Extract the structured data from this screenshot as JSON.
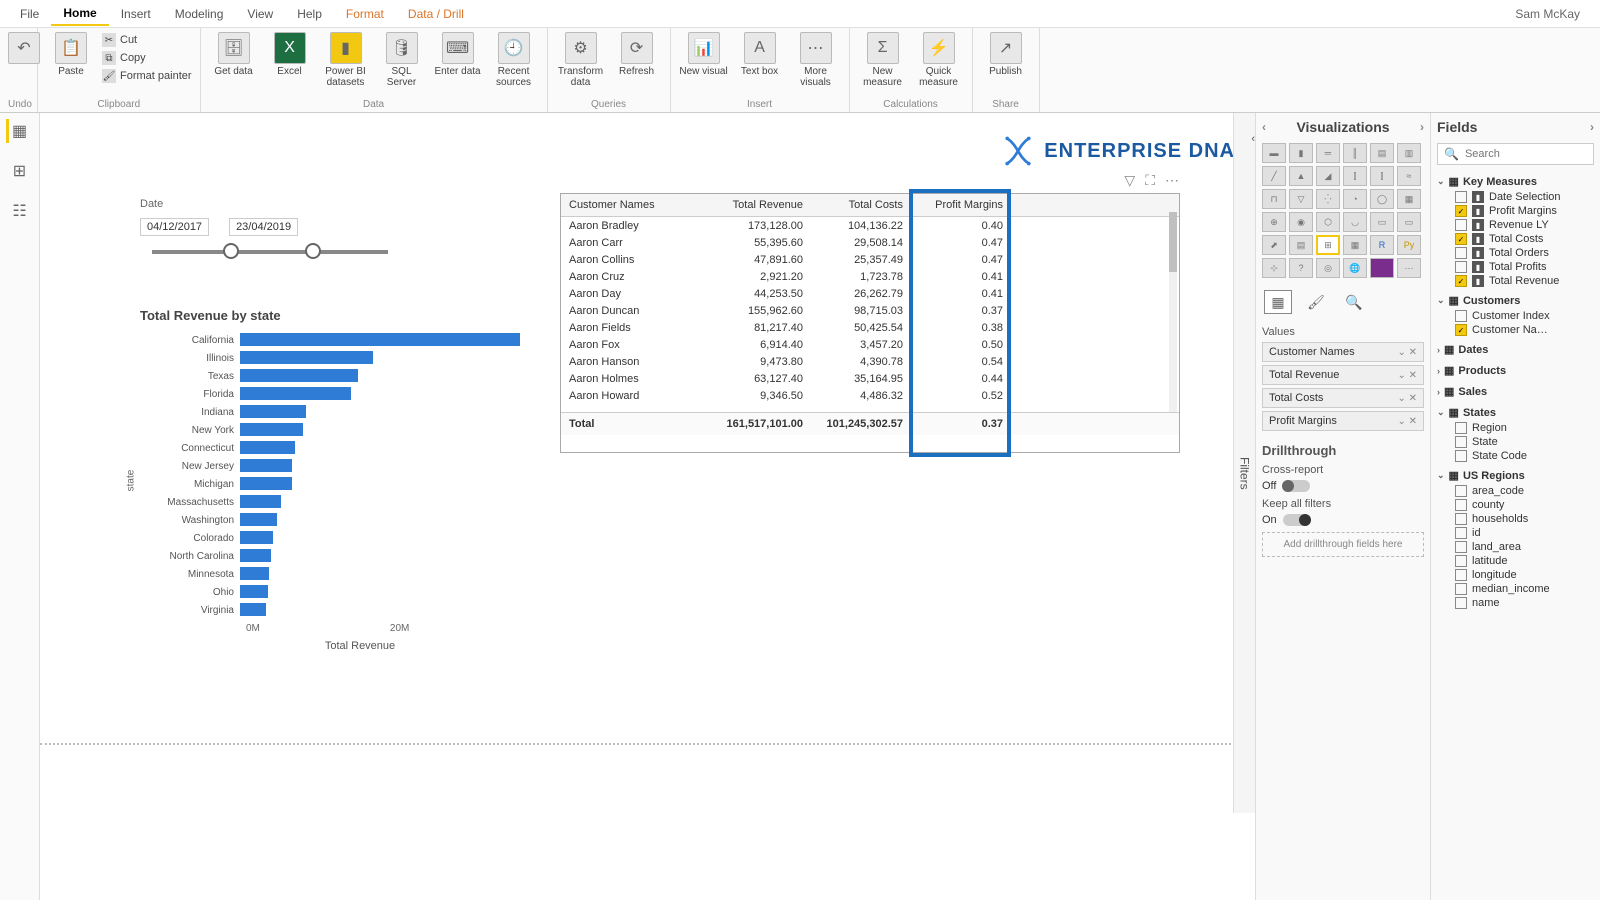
{
  "user": "Sam McKay",
  "menu": {
    "file": "File",
    "home": "Home",
    "insert": "Insert",
    "modeling": "Modeling",
    "view": "View",
    "help": "Help",
    "format": "Format",
    "datadrill": "Data / Drill"
  },
  "ribbon": {
    "undo": "Undo",
    "paste": "Paste",
    "cut": "Cut",
    "copy": "Copy",
    "formatpainter": "Format painter",
    "clipboard": "Clipboard",
    "getdata": "Get data",
    "excel": "Excel",
    "pbidata": "Power BI datasets",
    "sqlserver": "SQL Server",
    "enterdata": "Enter data",
    "recentsources": "Recent sources",
    "data": "Data",
    "transform": "Transform data",
    "refresh": "Refresh",
    "queries": "Queries",
    "newvisual": "New visual",
    "textbox": "Text box",
    "morevisuals": "More visuals",
    "insert": "Insert",
    "newmeasure": "New measure",
    "quickmeasure": "Quick measure",
    "calculations": "Calculations",
    "publish": "Publish",
    "share": "Share"
  },
  "logo": "ENTERPRISE DNA",
  "dateSlicer": {
    "title": "Date",
    "from": "04/12/2017",
    "to": "23/04/2019"
  },
  "chart_data": {
    "type": "bar",
    "title": "Total Revenue by state",
    "xlabel": "Total Revenue",
    "ylabel": "state",
    "xticks": [
      "0M",
      "20M"
    ],
    "categories": [
      "California",
      "Illinois",
      "Texas",
      "Florida",
      "Indiana",
      "New York",
      "Connecticut",
      "New Jersey",
      "Michigan",
      "Massachusetts",
      "Washington",
      "Colorado",
      "North Carolina",
      "Minnesota",
      "Ohio",
      "Virginia"
    ],
    "values": [
      38,
      18,
      16,
      15,
      9,
      8.5,
      7.5,
      7,
      7,
      5.5,
      5,
      4.5,
      4.2,
      4,
      3.8,
      3.5
    ]
  },
  "table": {
    "headers": [
      "Customer Names",
      "Total Revenue",
      "Total Costs",
      "Profit Margins"
    ],
    "rows": [
      [
        "Aaron Bradley",
        "173,128.00",
        "104,136.22",
        "0.40"
      ],
      [
        "Aaron Carr",
        "55,395.60",
        "29,508.14",
        "0.47"
      ],
      [
        "Aaron Collins",
        "47,891.60",
        "25,357.49",
        "0.47"
      ],
      [
        "Aaron Cruz",
        "2,921.20",
        "1,723.78",
        "0.41"
      ],
      [
        "Aaron Day",
        "44,253.50",
        "26,262.79",
        "0.41"
      ],
      [
        "Aaron Duncan",
        "155,962.60",
        "98,715.03",
        "0.37"
      ],
      [
        "Aaron Fields",
        "81,217.40",
        "50,425.54",
        "0.38"
      ],
      [
        "Aaron Fox",
        "6,914.40",
        "3,457.20",
        "0.50"
      ],
      [
        "Aaron Hanson",
        "9,473.80",
        "4,390.78",
        "0.54"
      ],
      [
        "Aaron Holmes",
        "63,127.40",
        "35,164.95",
        "0.44"
      ],
      [
        "Aaron Howard",
        "9,346.50",
        "4,486.32",
        "0.52"
      ]
    ],
    "footer": [
      "Total",
      "161,517,101.00",
      "101,245,302.57",
      "0.37"
    ]
  },
  "filters_label": "Filters",
  "viz": {
    "title": "Visualizations",
    "values": "Values",
    "wells": [
      "Customer Names",
      "Total Revenue",
      "Total Costs",
      "Profit Margins"
    ],
    "drill": "Drillthrough",
    "cross": "Cross-report",
    "off": "Off",
    "on": "On",
    "keep": "Keep all filters",
    "drilldrop": "Add drillthrough fields here"
  },
  "fields": {
    "title": "Fields",
    "search": "Search",
    "tables": [
      {
        "name": "Key Measures",
        "expanded": true,
        "items": [
          {
            "name": "Date Selection",
            "checked": false,
            "type": "m"
          },
          {
            "name": "Profit Margins",
            "checked": true,
            "type": "m"
          },
          {
            "name": "Revenue LY",
            "checked": false,
            "type": "m"
          },
          {
            "name": "Total Costs",
            "checked": true,
            "type": "m"
          },
          {
            "name": "Total Orders",
            "checked": false,
            "type": "m"
          },
          {
            "name": "Total Profits",
            "checked": false,
            "type": "m"
          },
          {
            "name": "Total Revenue",
            "checked": true,
            "type": "m"
          }
        ]
      },
      {
        "name": "Customers",
        "expanded": true,
        "items": [
          {
            "name": "Customer Index",
            "checked": false,
            "type": "c"
          },
          {
            "name": "Customer Na…",
            "checked": true,
            "type": "c"
          }
        ]
      },
      {
        "name": "Dates",
        "expanded": false,
        "items": []
      },
      {
        "name": "Products",
        "expanded": false,
        "items": []
      },
      {
        "name": "Sales",
        "expanded": false,
        "items": []
      },
      {
        "name": "States",
        "expanded": true,
        "items": [
          {
            "name": "Region",
            "checked": false,
            "type": "c"
          },
          {
            "name": "State",
            "checked": false,
            "type": "c"
          },
          {
            "name": "State Code",
            "checked": false,
            "type": "c"
          }
        ]
      },
      {
        "name": "US Regions",
        "expanded": true,
        "items": [
          {
            "name": "area_code",
            "checked": false,
            "type": "c"
          },
          {
            "name": "county",
            "checked": false,
            "type": "c"
          },
          {
            "name": "households",
            "checked": false,
            "type": "c"
          },
          {
            "name": "id",
            "checked": false,
            "type": "c"
          },
          {
            "name": "land_area",
            "checked": false,
            "type": "c"
          },
          {
            "name": "latitude",
            "checked": false,
            "type": "c"
          },
          {
            "name": "longitude",
            "checked": false,
            "type": "c"
          },
          {
            "name": "median_income",
            "checked": false,
            "type": "c"
          },
          {
            "name": "name",
            "checked": false,
            "type": "c"
          }
        ]
      }
    ]
  }
}
